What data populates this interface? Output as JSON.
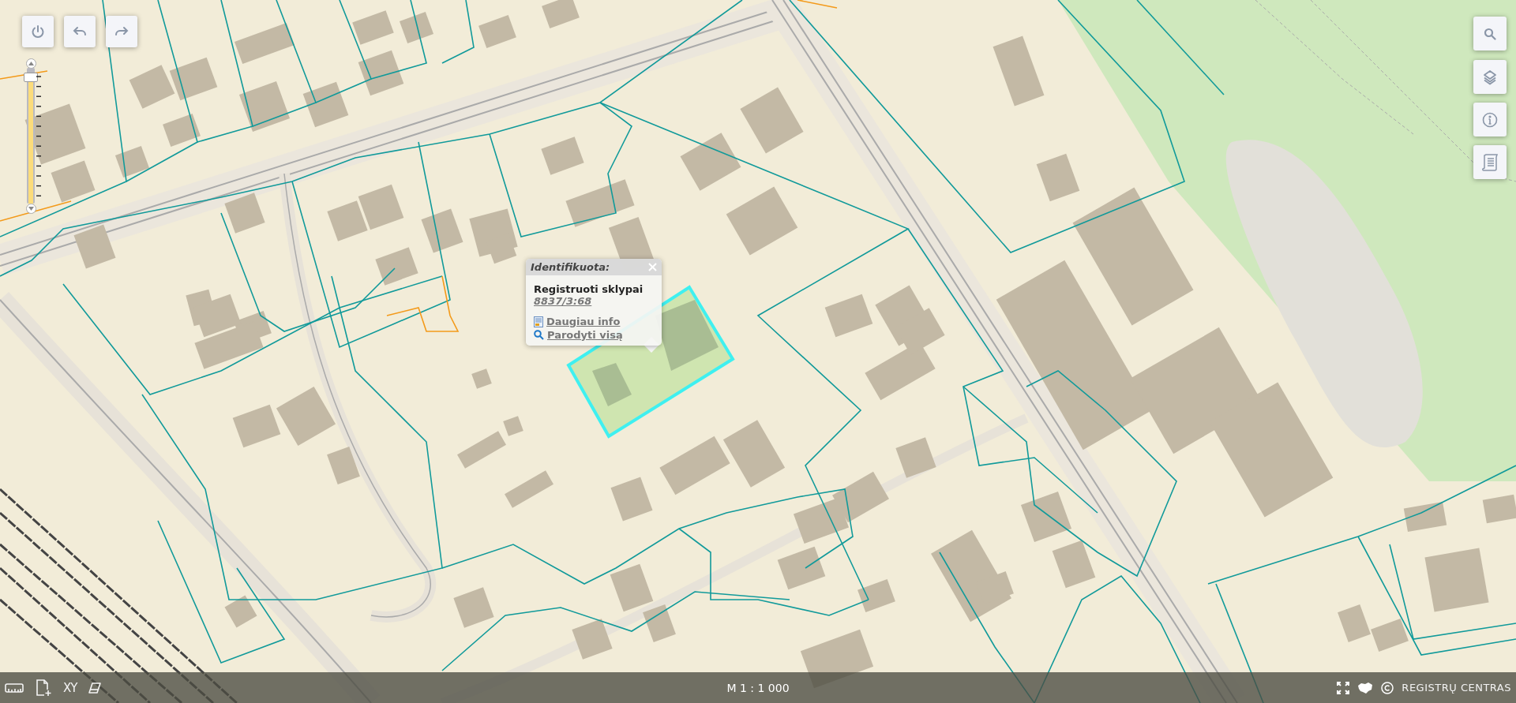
{
  "top_controls": [
    {
      "kind": "power"
    },
    {
      "kind": "back"
    },
    {
      "kind": "forward"
    }
  ],
  "zoom_slider": {
    "level": 0.93
  },
  "side_buttons": [
    {
      "kind": "search"
    },
    {
      "kind": "layers"
    },
    {
      "kind": "info"
    },
    {
      "kind": "legend"
    }
  ],
  "popup": {
    "title": "Identifikuota:",
    "layer": "Registruoti sklypai",
    "parcel_id": "8837/3:68",
    "links": [
      {
        "kind": "info",
        "label": "Daugiau info"
      },
      {
        "kind": "zoom",
        "label": "Parodyti visą"
      }
    ]
  },
  "bottom_bar": {
    "tools": [
      {
        "kind": "measure"
      },
      {
        "kind": "add-document"
      },
      {
        "kind": "coordinates",
        "label": "XY"
      },
      {
        "kind": "eraser"
      }
    ],
    "scale": "M 1 : 1 000",
    "icons": [
      {
        "kind": "fullscreen"
      },
      {
        "kind": "country"
      },
      {
        "kind": "copyright"
      }
    ],
    "brand": "REGISTRŲ CENTRAS"
  }
}
